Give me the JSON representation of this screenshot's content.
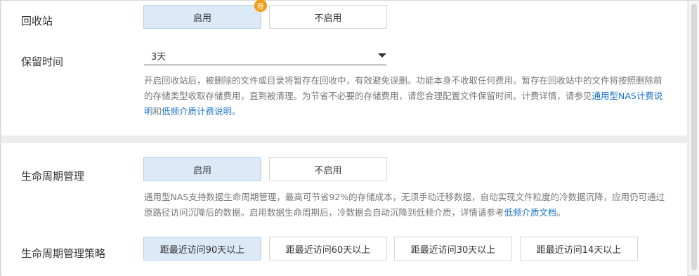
{
  "recycle": {
    "label": "回收站",
    "enable": "启用",
    "enable_badge": "荐",
    "disable": "不启用",
    "retention_label": "保留时间",
    "retention_value": "3天",
    "desc_text1": "开启回收站后，被删除的文件或目录将暂存在回收中，有效避免误删。功能本身不收取任何费用。暂存在回收站中的文件将按照删除前的存储类型收取存储费用，直到被清理。为节省不必要的存储费用，请您合理配置文件保留时间。计费详情，请参见",
    "link1": "通用型NAS计费说明",
    "desc_and": "和",
    "link2": "低频介质计费说明",
    "desc_end": "。"
  },
  "lifecycle": {
    "label": "生命周期管理",
    "enable": "启用",
    "disable": "不启用",
    "desc_text": "通用型NAS支持数据生命周期管理，最高可节省92%的存储成本，无须手动迁移数据，自动实现文件粒度的冷数据沉降，应用仍可通过原路径访问沉降后的数据。启用数据生命周期后，冷数据会自动沉降到低频介质，详情请参考",
    "link": "低频介质文档",
    "desc_end": "。",
    "policy_label": "生命周期管理策略",
    "policies": [
      "距最近访问90天以上",
      "距最近访问60天以上",
      "距最近访问30天以上",
      "距最近访问14天以上"
    ]
  },
  "colors": {
    "accent": "#1a73c8",
    "active_bg": "#dce9f7",
    "badge": "#f39c12"
  }
}
